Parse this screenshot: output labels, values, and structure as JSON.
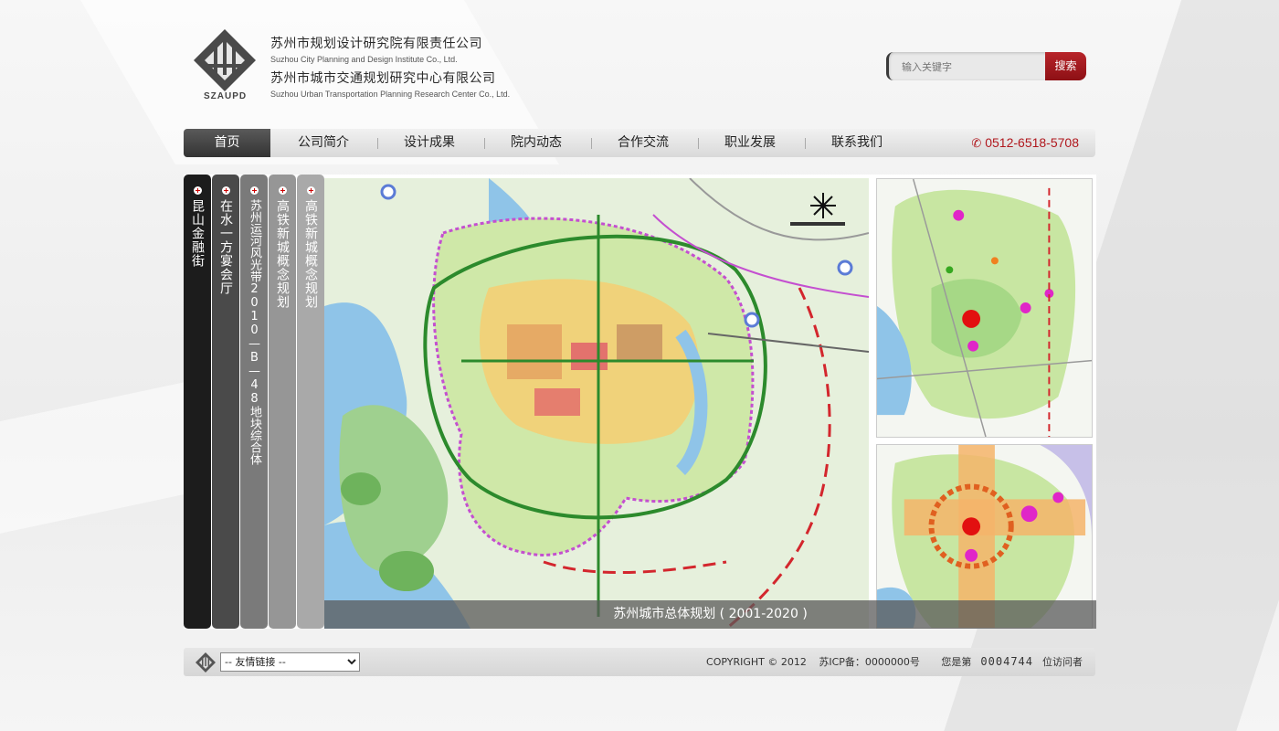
{
  "header": {
    "logo_text": "SZAUPD",
    "company_cn_1": "苏州市规划设计研究院有限责任公司",
    "company_en_1": "Suzhou City Planning and Design Institute Co., Ltd.",
    "company_cn_2": "苏州市城市交通规划研究中心有限公司",
    "company_en_2": "Suzhou Urban Transportation Planning Research Center Co., Ltd."
  },
  "search": {
    "placeholder": "输入关键字",
    "button_label": "搜索"
  },
  "nav": {
    "items": [
      {
        "label": "首页"
      },
      {
        "label": "公司简介"
      },
      {
        "label": "设计成果"
      },
      {
        "label": "院内动态"
      },
      {
        "label": "合作交流"
      },
      {
        "label": "职业发展"
      },
      {
        "label": "联系我们"
      }
    ],
    "phone": "0512-6518-5708"
  },
  "tabs": [
    {
      "label": "昆山金融街",
      "color": "#1c1c1c"
    },
    {
      "label": "在水一方宴会厅",
      "color": "#4a4a4a"
    },
    {
      "label": "苏州运河风光带2010—B—48地块综合体",
      "color": "#7a7a7a"
    },
    {
      "label": "高铁新城概念规划",
      "color": "#969696"
    },
    {
      "label": "高铁新城概念规划",
      "color": "#a9a9a9"
    }
  ],
  "caption": "苏州城市总体规划 ( 2001-2020 )",
  "footer": {
    "links_select": "-- 友情链接 --",
    "copyright": "COPYRIGHT © 2012",
    "icp": "苏ICP备：0000000号",
    "visitor_prefix": "您是第",
    "visitor_count": "0004744",
    "visitor_suffix": "位访问者"
  },
  "colors": {
    "accent_red": "#b0171d",
    "nav_active": "#3a3a3a"
  }
}
